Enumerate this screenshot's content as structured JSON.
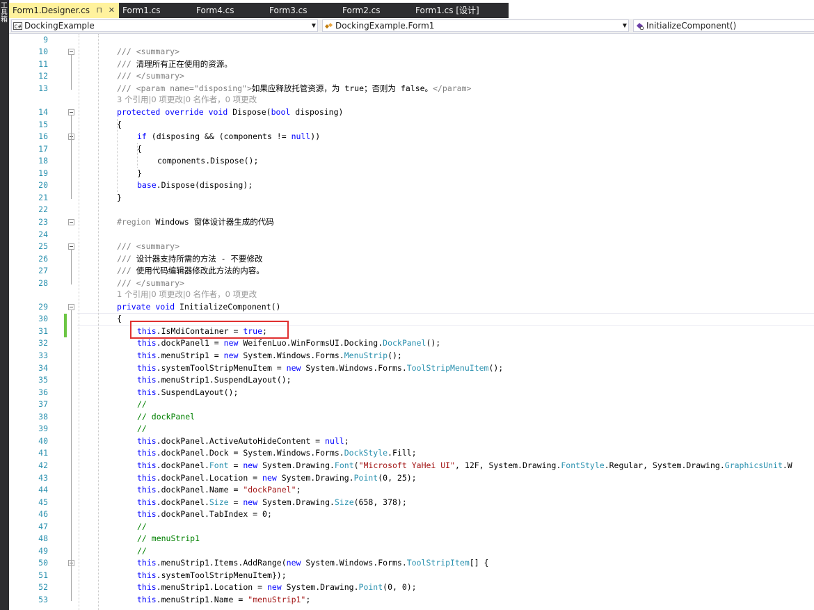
{
  "side_label": "工具箱",
  "tabs": [
    {
      "label": "Form1.Designer.cs",
      "active": true,
      "pin": "⊓",
      "close": "✕"
    },
    {
      "label": "Form1.cs"
    },
    {
      "label": "Form4.cs"
    },
    {
      "label": "Form3.cs"
    },
    {
      "label": "Form2.cs"
    },
    {
      "label": "Form1.cs [设计]"
    }
  ],
  "nav": {
    "project": "DockingExample",
    "class": "DockingExample.Form1",
    "member": "InitializeComponent()"
  },
  "line_numbers": [
    "9",
    "10",
    "11",
    "12",
    "13",
    "14",
    "15",
    "16",
    "17",
    "18",
    "19",
    "20",
    "21",
    "22",
    "23",
    "24",
    "25",
    "26",
    "27",
    "28",
    "29",
    "30",
    "31",
    "32",
    "33",
    "34",
    "35",
    "36",
    "37",
    "38",
    "39",
    "40",
    "41",
    "42",
    "43",
    "44",
    "45",
    "46",
    "47",
    "48",
    "49",
    "50",
    "51",
    "52",
    "53"
  ],
  "codelens": {
    "dispose": "3 个引用|0 项更改|0 名作者，0 项更改",
    "init": "1 个引用|0 项更改|0 名作者，0 项更改"
  },
  "code": {
    "l10": "/// <summary>",
    "l11": "/// 清理所有正在使用的资源。",
    "l12": "/// </summary>",
    "l13": "/// <param name=\"disposing\">如果应释放托管资源，为 true；否则为 false。</param>",
    "l14": "protected override void Dispose(bool disposing)",
    "l15": "{",
    "l16": "if (disposing && (components != null))",
    "l17": "{",
    "l18": "components.Dispose();",
    "l19": "}",
    "l20": "base.Dispose(disposing);",
    "l21": "}",
    "l23": "#region Windows 窗体设计器生成的代码",
    "l25": "/// <summary>",
    "l26": "/// 设计器支持所需的方法 - 不要修改",
    "l27": "/// 使用代码编辑器修改此方法的内容。",
    "l28": "/// </summary>",
    "l29": "private void InitializeComponent()",
    "l30": "{",
    "l31": "this.IsMdiContainer = true;",
    "l32": "this.dockPanel1 = new WeifenLuo.WinFormsUI.Docking.DockPanel();",
    "l33": "this.menuStrip1 = new System.Windows.Forms.MenuStrip();",
    "l34": "this.systemToolStripMenuItem = new System.Windows.Forms.ToolStripMenuItem();",
    "l35": "this.menuStrip1.SuspendLayout();",
    "l36": "this.SuspendLayout();",
    "l37": "//",
    "l38": "// dockPanel",
    "l39": "//",
    "l40": "this.dockPanel.ActiveAutoHideContent = null;",
    "l41": "this.dockPanel.Dock = System.Windows.Forms.DockStyle.Fill;",
    "l42": "this.dockPanel.Font = new System.Drawing.Font(\"Microsoft YaHei UI\", 12F, System.Drawing.FontStyle.Regular, System.Drawing.GraphicsUnit.W",
    "l43": "this.dockPanel.Location = new System.Drawing.Point(0, 25);",
    "l44": "this.dockPanel.Name = \"dockPanel\";",
    "l45": "this.dockPanel.Size = new System.Drawing.Size(658, 378);",
    "l46": "this.dockPanel.TabIndex = 0;",
    "l47": "//",
    "l48": "// menuStrip1",
    "l49": "//",
    "l50": "this.menuStrip1.Items.AddRange(new System.Windows.Forms.ToolStripItem[] {",
    "l51": "this.systemToolStripMenuItem});",
    "l52": "this.menuStrip1.Location = new System.Drawing.Point(0, 0);",
    "l53": "this.menuStrip1.Name = \"menuStrip1\";"
  }
}
